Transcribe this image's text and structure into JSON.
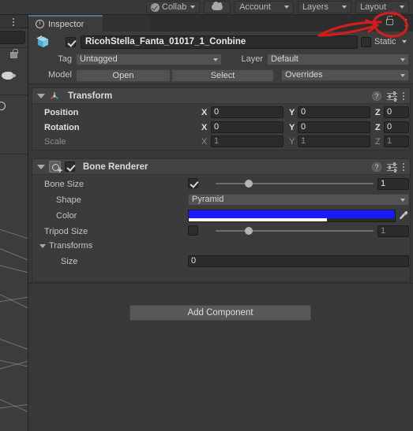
{
  "toolbar": {
    "collab": {
      "label": "Collab",
      "icon": "collab-check-icon"
    },
    "cloud": {
      "icon": "cloud-icon"
    },
    "account": {
      "label": "Account"
    },
    "layers": {
      "label": "Layers"
    },
    "layout": {
      "label": "Layout"
    }
  },
  "inspector": {
    "tab_label": "Inspector",
    "tab_icon": "info-icon",
    "lock_icon": "lock-open-icon",
    "menu_icon": "kebab-menu-icon"
  },
  "object": {
    "icon": "prefab-cube-icon",
    "enabled": true,
    "name": "RicohStella_Fanta_01017_1_Conbine",
    "static_label": "Static",
    "static_checked": false,
    "tag_label": "Tag",
    "tag_value": "Untagged",
    "layer_label": "Layer",
    "layer_value": "Default",
    "model_label": "Model",
    "open_button": "Open",
    "select_button": "Select",
    "overrides_dropdown": "Overrides"
  },
  "transform": {
    "title": "Transform",
    "icon": "transform-axis-icon",
    "help_icon": "help-icon",
    "preset_icon": "preset-sliders-icon",
    "menu_icon": "kebab-menu-icon",
    "rows": [
      {
        "label": "Position",
        "bold": true,
        "x": "0",
        "y": "0",
        "z": "0"
      },
      {
        "label": "Rotation",
        "bold": true,
        "x": "0",
        "y": "0",
        "z": "0"
      },
      {
        "label": "Scale",
        "bold": false,
        "x": "1",
        "y": "1",
        "z": "1"
      }
    ],
    "axis_labels": [
      "X",
      "Y",
      "Z"
    ]
  },
  "bone_renderer": {
    "title": "Bone Renderer",
    "icon": "script-component-icon",
    "enabled": true,
    "help_icon": "help-icon",
    "preset_icon": "preset-sliders-icon",
    "menu_icon": "kebab-menu-icon",
    "bone_size": {
      "label": "Bone Size",
      "checked": true,
      "slider_pct": 21,
      "value": "1"
    },
    "shape": {
      "label": "Shape",
      "value": "Pyramid"
    },
    "color": {
      "label": "Color",
      "hex": "#1a1aff",
      "alpha_pct": 67,
      "eyedropper_icon": "eyedropper-icon"
    },
    "tripod_size": {
      "label": "Tripod Size",
      "checked": false,
      "slider_pct": 21,
      "value": "1"
    },
    "transforms": {
      "label": "Transforms",
      "expanded": true
    },
    "size": {
      "label": "Size",
      "value": "0"
    }
  },
  "add_component_button": "Add Component",
  "annotation": {
    "type": "red-arrow-circle",
    "color": "#d01d1d",
    "targets": "lock-open-icon"
  },
  "colors": {
    "panel_bg": "#383838",
    "header_bg": "#3c3c3c",
    "component_bg": "#3b3b3b",
    "component_header": "#434343",
    "field_bg": "#2b2b2b",
    "dropdown_bg": "#525252",
    "tab_accent": "#4a7a9b",
    "text": "#c4c4c4",
    "bone_color": "#1a1aff"
  }
}
